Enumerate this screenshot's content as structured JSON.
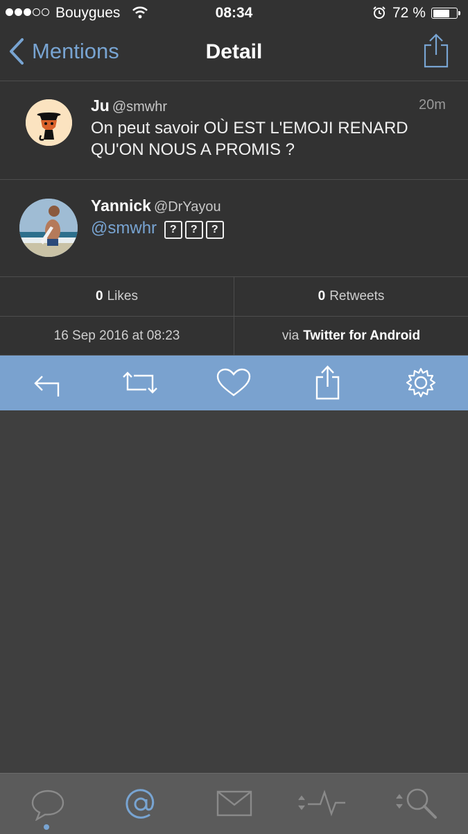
{
  "status_bar": {
    "carrier": "Bouygues",
    "time": "08:34",
    "battery": "72 %",
    "battery_level": 0.72
  },
  "nav": {
    "back_label": "Mentions",
    "title": "Detail"
  },
  "tweets": [
    {
      "name": "Ju",
      "handle": "@smwhr",
      "time": "20m",
      "text": "On peut savoir OÙ EST L'EMOJI RENARD QU'ON NOUS A PROMIS ?"
    },
    {
      "name": "Yannick",
      "handle": "@DrYayou",
      "mention": "@smwhr",
      "unknown_glyphs": [
        "?",
        "?",
        "?"
      ]
    }
  ],
  "stats": {
    "likes_count": "0",
    "likes_label": "Likes",
    "retweets_count": "0",
    "retweets_label": "Retweets",
    "date": "16 Sep 2016 at 08:23",
    "via_label": "via",
    "via_source": "Twitter for Android"
  },
  "actions": [
    "reply-icon",
    "retweet-icon",
    "like-icon",
    "share-icon",
    "settings-icon"
  ],
  "tabbar": [
    "timeline-icon",
    "mentions-icon",
    "messages-icon",
    "activity-icon",
    "search-icon"
  ],
  "colors": {
    "accent": "#78a4d2",
    "action_bar": "#7aa2cf",
    "background": "#3f3f3f",
    "cell": "#323232",
    "tabbar": "#5b5b5b"
  }
}
